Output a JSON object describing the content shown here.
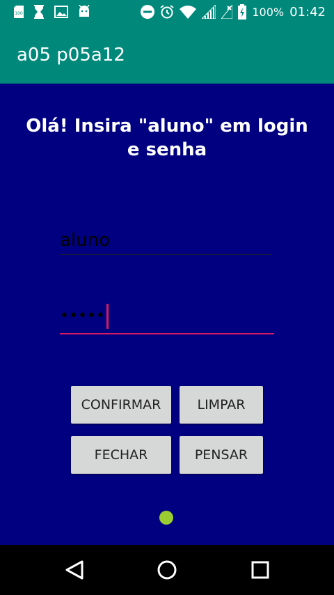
{
  "status_bar": {
    "battery_percent": "100%",
    "time": "01:42",
    "icons": [
      "sd-card-icon",
      "hourglass-icon",
      "image-icon",
      "android-icon",
      "do-not-disturb-icon",
      "alarm-icon",
      "wifi-icon",
      "signal-icon",
      "no-signal-icon",
      "battery-charging-icon"
    ]
  },
  "app_bar": {
    "title": "a05 p05a12"
  },
  "main": {
    "heading": "Olá! Insira \"aluno\" em login e senha",
    "login_value": "aluno",
    "senha_value": "•••••",
    "buttons": {
      "confirmar": "CONFIRMAR",
      "limpar": "LIMPAR",
      "fechar": "FECHAR",
      "pensar": "PENSAR"
    }
  },
  "colors": {
    "app_bar": "#00897b",
    "background": "#000080",
    "accent": "#d81b60",
    "button": "#d6d7d7",
    "dot": "#9acd32"
  }
}
